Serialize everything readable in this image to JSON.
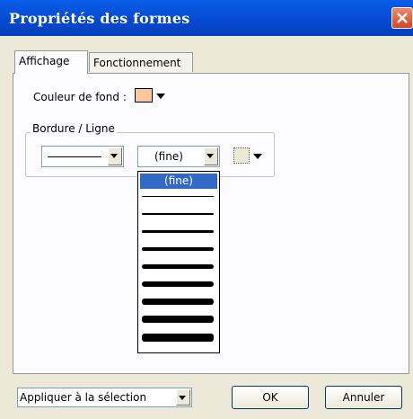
{
  "window": {
    "title": "Propriétés des formes"
  },
  "tabs": [
    {
      "label": "Affichage"
    },
    {
      "label": "Fonctionnement"
    }
  ],
  "fill": {
    "label": "Couleur de fond :",
    "color": "#fcc79b"
  },
  "border": {
    "group_label": "Bordure / Ligne",
    "width_value": "(fine)",
    "width_options": [
      "(fine)",
      "",
      "",
      "",
      "",
      "",
      "",
      "",
      "",
      ""
    ]
  },
  "footer": {
    "apply_select_value": "Appliquer à la sélection",
    "ok_label": "OK",
    "cancel_label": "Annuler"
  },
  "colors": {
    "titlebar": "#0a5ee8",
    "selection": "#316ac5",
    "close": "#d8431f"
  }
}
